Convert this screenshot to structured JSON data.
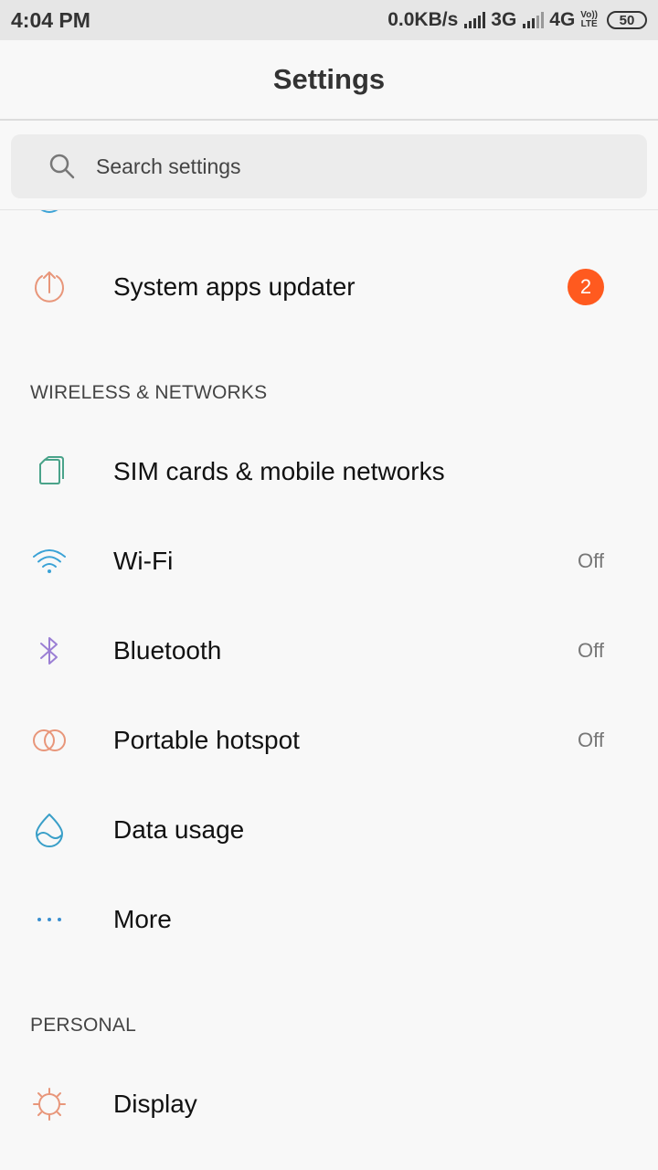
{
  "status_bar": {
    "time": "4:04 PM",
    "net_speed": "0.0KB/s",
    "network1": "3G",
    "network2": "4G",
    "volte_top": "Vo))",
    "volte_bottom": "LTE",
    "battery": "50"
  },
  "header": {
    "title": "Settings"
  },
  "search": {
    "placeholder": "Search settings"
  },
  "items": {
    "system_apps_updater": {
      "label": "System apps updater",
      "badge": "2"
    },
    "sim_cards": {
      "label": "SIM cards & mobile networks"
    },
    "wifi": {
      "label": "Wi-Fi",
      "value": "Off"
    },
    "bluetooth": {
      "label": "Bluetooth",
      "value": "Off"
    },
    "hotspot": {
      "label": "Portable hotspot",
      "value": "Off"
    },
    "data_usage": {
      "label": "Data usage"
    },
    "more": {
      "label": "More"
    },
    "display": {
      "label": "Display"
    }
  },
  "sections": {
    "wireless": "WIRELESS & NETWORKS",
    "personal": "PERSONAL"
  },
  "colors": {
    "badge": "#ff5a1f",
    "updater_icon": "#e8967a",
    "sim_icon": "#4aa38a",
    "wifi_icon": "#3aa2d6",
    "bluetooth_icon": "#9b7fd4",
    "hotspot_icon": "#e8967a",
    "data_icon": "#3a9fc8",
    "more_icon": "#3a8fd0",
    "display_icon": "#e8967a"
  },
  "icons": {
    "search": "search-icon",
    "updater": "upload-circle-icon",
    "sim": "sim-card-icon",
    "wifi": "wifi-icon",
    "bluetooth": "bluetooth-icon",
    "hotspot": "hotspot-icon",
    "data": "water-drop-icon",
    "more": "more-dots-icon",
    "display": "sun-icon"
  }
}
